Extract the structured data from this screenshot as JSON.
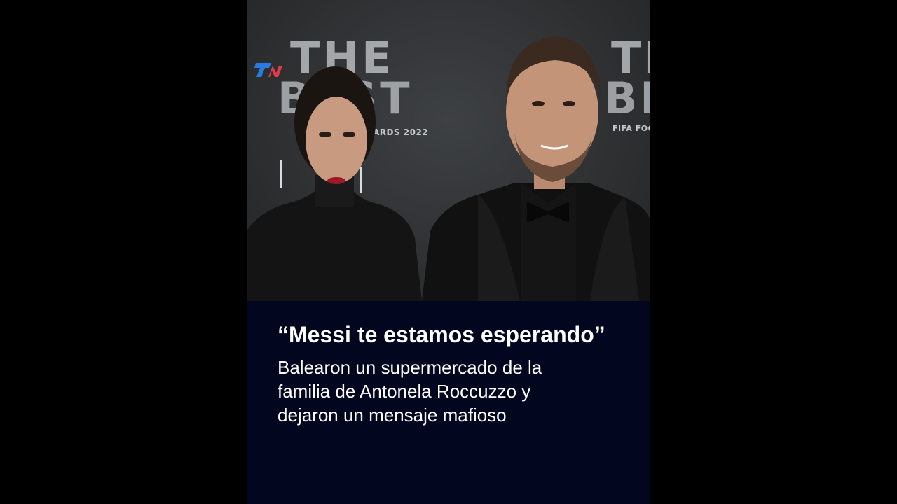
{
  "video": {
    "channel_logo": "TN",
    "backdrop": {
      "logo_line_1": "THE",
      "logo_line_2": "BEST",
      "caption_left": "ARDS 2022",
      "caption_right": "FIFA FOO"
    },
    "colors": {
      "caption_background": "#02061f",
      "letterbox": "#000000",
      "tn_logo": "#2a7be0"
    }
  },
  "caption": {
    "headline": "“Messi te estamos esperando”",
    "subhead_lines": [
      "Balearon un supermercado de la",
      "familia de Antonela Roccuzzo y",
      "dejaron un mensaje mafioso"
    ]
  }
}
